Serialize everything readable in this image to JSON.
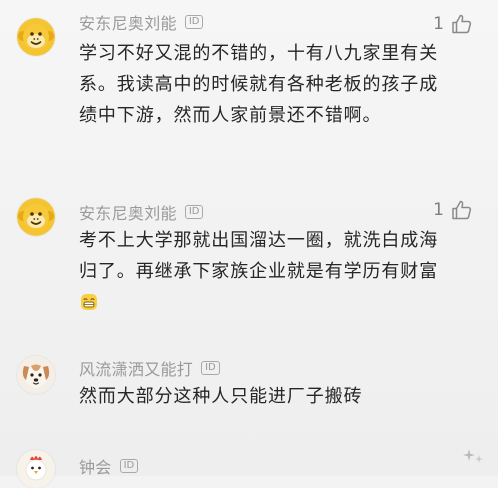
{
  "comments": [
    {
      "username": "安东尼奥刘能",
      "id_badge": "ID",
      "likes": "1",
      "avatar_icon": "yellow-monkey-avatar",
      "text": "学习不好又混的不错的，十有八九家里有关系。我读高中的时候就有各种老板的孩子成绩中下游，然而人家前景还不错啊。"
    },
    {
      "username": "安东尼奥刘能",
      "id_badge": "ID",
      "likes": "1",
      "avatar_icon": "yellow-monkey-avatar",
      "text": "考不上大学那就出国溜达一圈，就洗白成海归了。再继承下家族企业就是有学历有财富",
      "emoji": "grin-face-emoji"
    },
    {
      "username": "风流潇洒又能打",
      "id_badge": "ID",
      "avatar_icon": "puppy-avatar",
      "text": "然而大部分这种人只能进厂子搬砖"
    },
    {
      "username": "钟会",
      "id_badge": "ID",
      "avatar_icon": "chicken-avatar"
    }
  ],
  "colors": {
    "username": "#9a9a9a",
    "content": "#262626",
    "like_count": "#7f7f7f",
    "avatar_monkey": "#f2c335",
    "background": "#f3f3f3"
  },
  "icons": {
    "like": "thumbs-up-icon",
    "watermark": "sparkle-watermark-icon"
  }
}
